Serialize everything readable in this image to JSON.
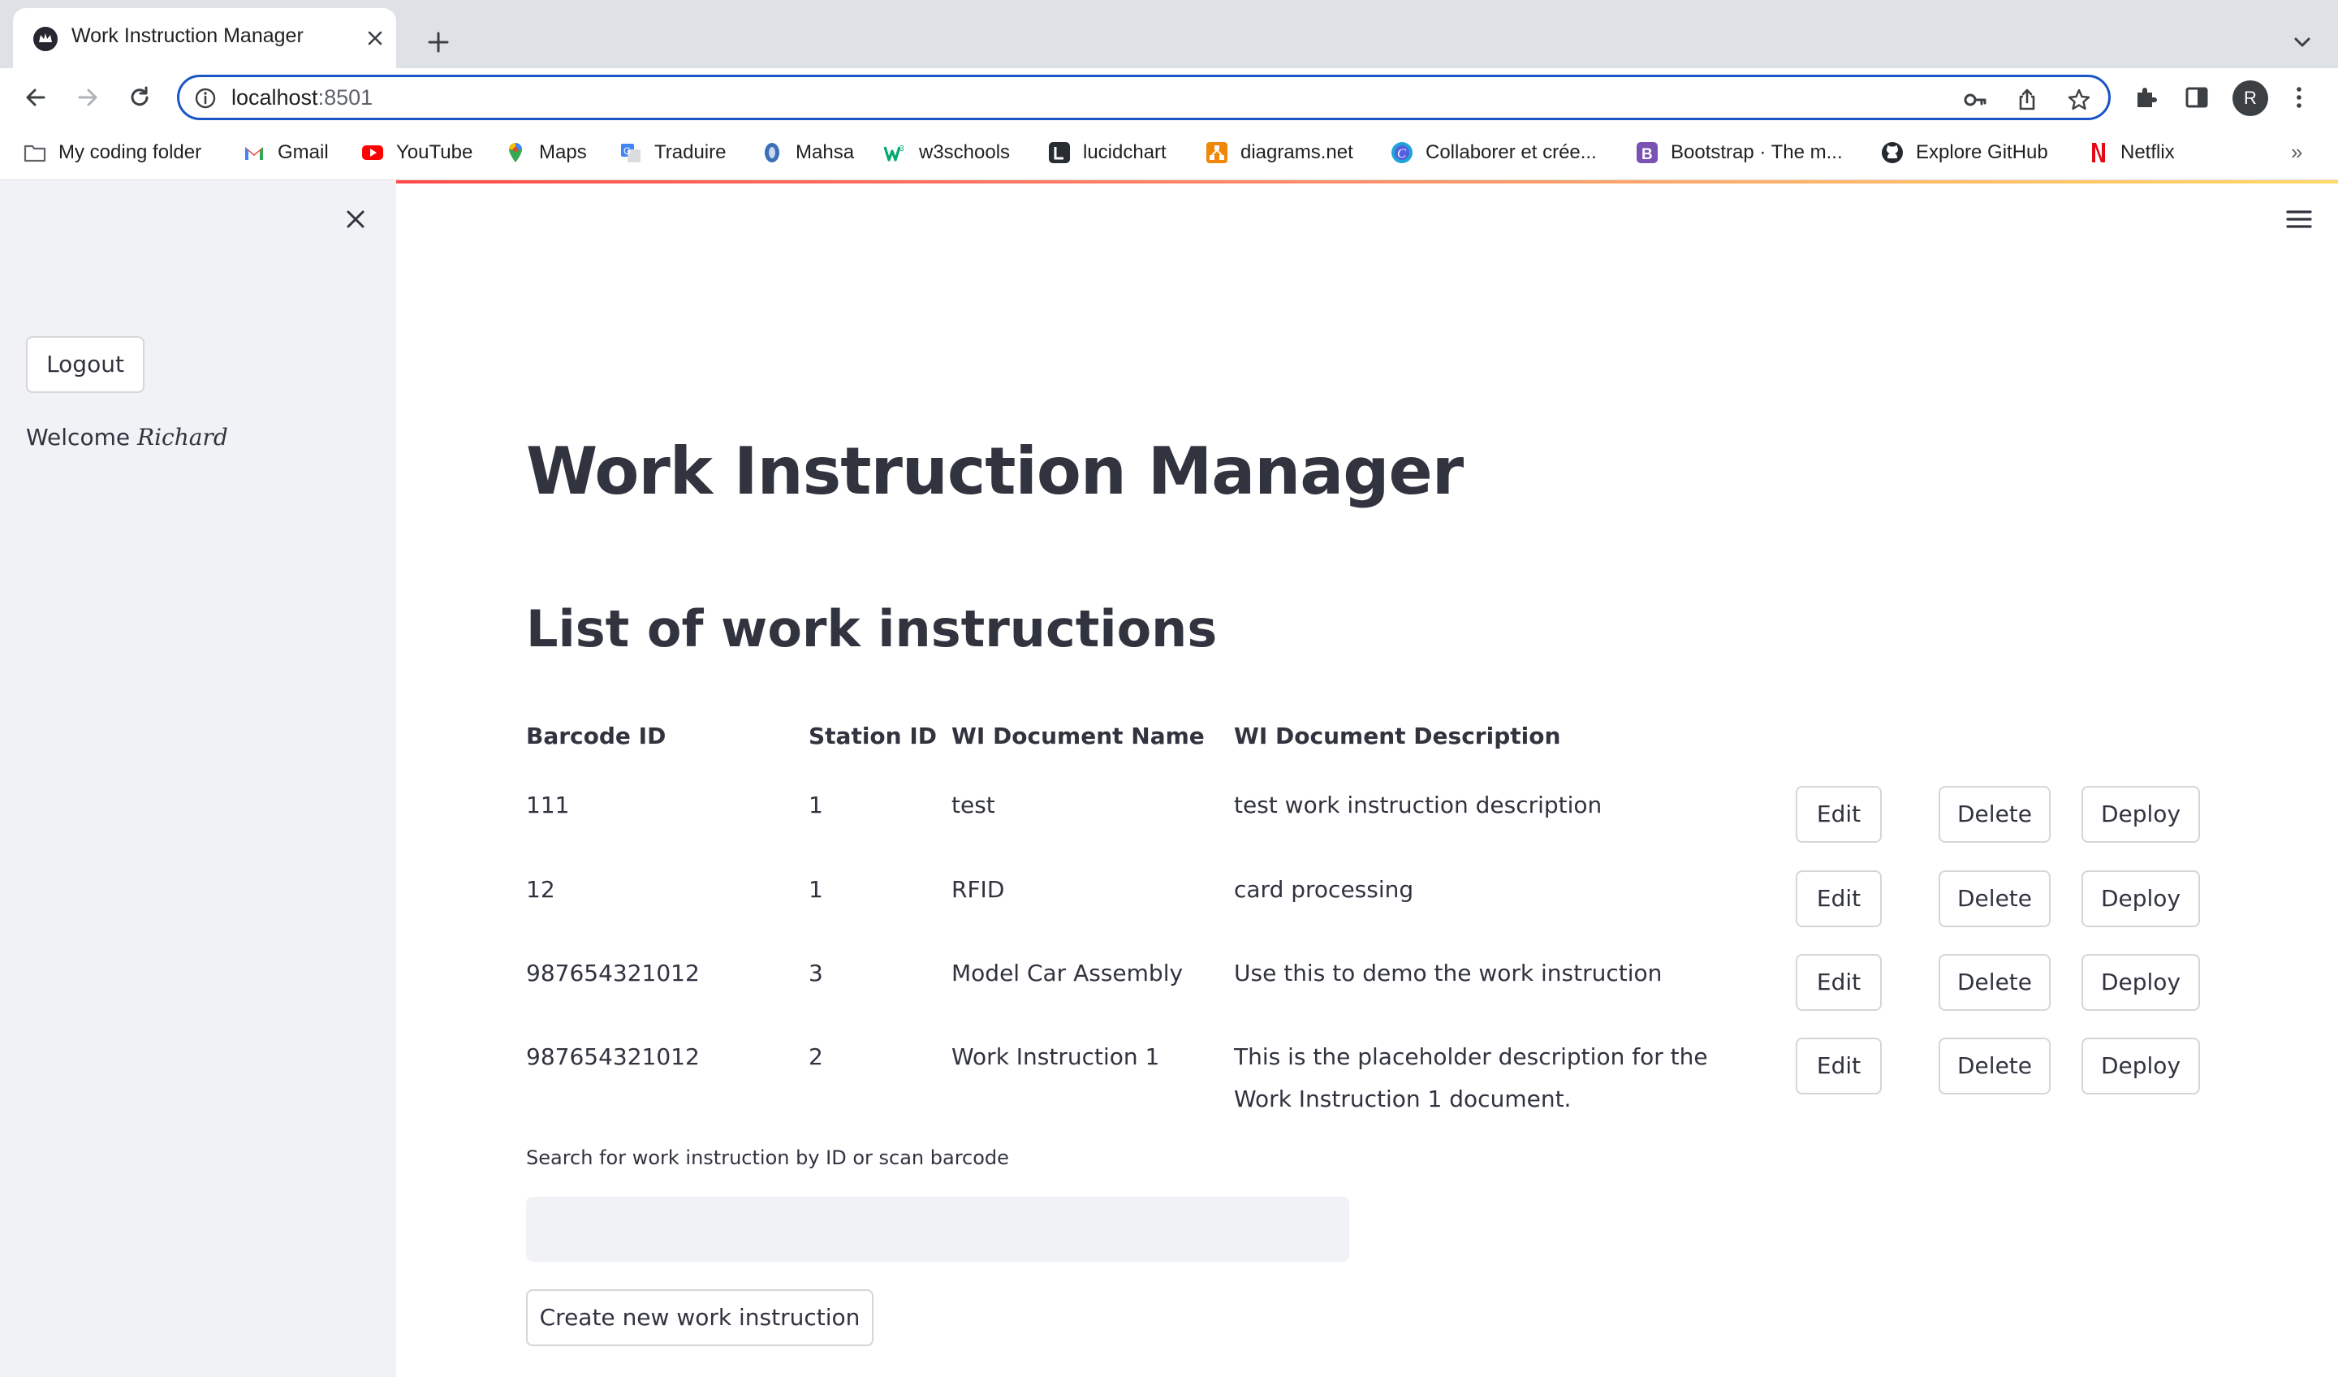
{
  "browser": {
    "tab_title": "Work Instruction Manager",
    "url_host": "localhost",
    "url_port": ":8501",
    "profile_initial": "R",
    "bookmarks": [
      {
        "label": "My coding folder",
        "icon": "folder-icon"
      },
      {
        "label": "Gmail",
        "icon": "gmail-icon"
      },
      {
        "label": "YouTube",
        "icon": "youtube-icon"
      },
      {
        "label": "Maps",
        "icon": "maps-icon"
      },
      {
        "label": "Traduire",
        "icon": "translate-icon"
      },
      {
        "label": "Mahsa",
        "icon": "mahsa-icon"
      },
      {
        "label": "w3schools",
        "icon": "w3schools-icon"
      },
      {
        "label": "lucidchart",
        "icon": "lucidchart-icon"
      },
      {
        "label": "diagrams.net",
        "icon": "diagrams-icon"
      },
      {
        "label": "Collaborer et crée...",
        "icon": "canva-icon"
      },
      {
        "label": "Bootstrap · The m...",
        "icon": "bootstrap-icon"
      },
      {
        "label": "Explore GitHub",
        "icon": "github-icon"
      },
      {
        "label": "Netflix",
        "icon": "netflix-icon"
      }
    ],
    "more_bookmarks": "»"
  },
  "sidebar": {
    "logout_label": "Logout",
    "welcome_prefix": "Welcome",
    "welcome_name": "Richard"
  },
  "main": {
    "title": "Work Instruction Manager",
    "subtitle": "List of work instructions",
    "table": {
      "headers": [
        "Barcode ID",
        "Station ID",
        "WI Document Name",
        "WI Document Description"
      ],
      "rows": [
        {
          "barcode": "111",
          "station": "1",
          "name": "test",
          "description": "test work instruction description"
        },
        {
          "barcode": "12",
          "station": "1",
          "name": "RFID",
          "description": "card processing"
        },
        {
          "barcode": "987654321012",
          "station": "3",
          "name": "Model Car Assembly",
          "description": "Use this to demo the work instruction"
        },
        {
          "barcode": "987654321012",
          "station": "2",
          "name": "Work Instruction 1",
          "description": "This is the placeholder description for the Work Instruction 1 document."
        }
      ],
      "actions": {
        "edit": "Edit",
        "delete": "Delete",
        "deploy": "Deploy"
      }
    },
    "search_label": "Search for work instruction by ID or scan barcode",
    "search_value": "",
    "create_label": "Create new work instruction"
  },
  "colors": {
    "text": "#31333f",
    "sidebar_bg": "#f0f2f6",
    "focus_blue": "#1a56c7",
    "accent_red": "#ff4b4b"
  }
}
